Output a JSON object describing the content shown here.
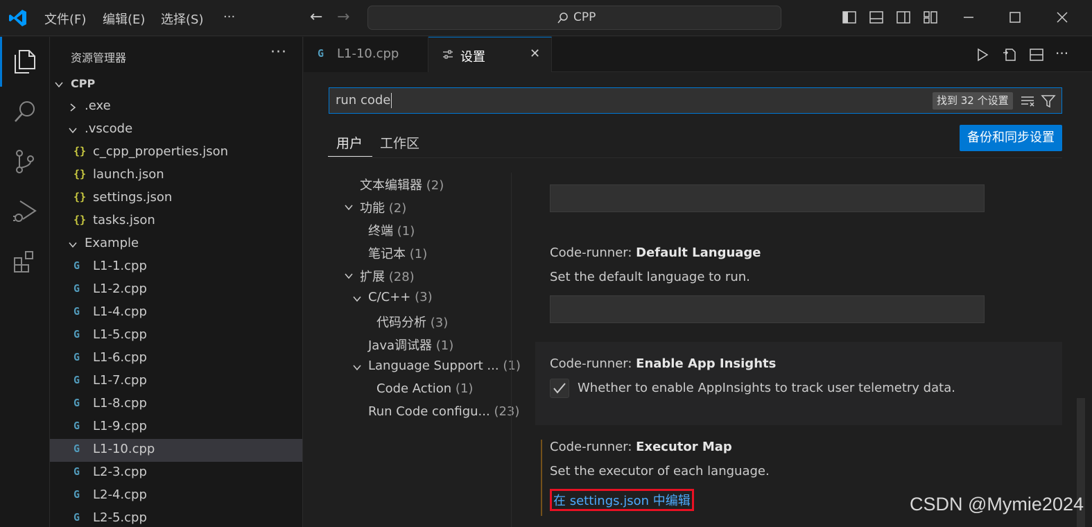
{
  "titlebar": {
    "menu": [
      "文件(F)",
      "编辑(E)",
      "选择(S)",
      "···"
    ],
    "search_text": "CPP"
  },
  "sidebar": {
    "title": "资源管理器",
    "more": "···",
    "tree": [
      {
        "label": "CPP",
        "type": "root"
      },
      {
        "label": ".exe",
        "type": "folder-collapsed"
      },
      {
        "label": ".vscode",
        "type": "folder-open"
      },
      {
        "label": "c_cpp_properties.json",
        "type": "json"
      },
      {
        "label": "launch.json",
        "type": "json"
      },
      {
        "label": "settings.json",
        "type": "json"
      },
      {
        "label": "tasks.json",
        "type": "json"
      },
      {
        "label": "Example",
        "type": "folder-open"
      },
      {
        "label": "L1-1.cpp",
        "type": "cpp"
      },
      {
        "label": "L1-2.cpp",
        "type": "cpp"
      },
      {
        "label": "L1-4.cpp",
        "type": "cpp"
      },
      {
        "label": "L1-5.cpp",
        "type": "cpp"
      },
      {
        "label": "L1-6.cpp",
        "type": "cpp"
      },
      {
        "label": "L1-7.cpp",
        "type": "cpp"
      },
      {
        "label": "L1-8.cpp",
        "type": "cpp"
      },
      {
        "label": "L1-9.cpp",
        "type": "cpp"
      },
      {
        "label": "L1-10.cpp",
        "type": "cpp",
        "selected": true
      },
      {
        "label": "L2-3.cpp",
        "type": "cpp"
      },
      {
        "label": "L2-4.cpp",
        "type": "cpp"
      },
      {
        "label": "L2-5.cpp",
        "type": "cpp"
      }
    ]
  },
  "tabs": [
    {
      "label": "L1-10.cpp",
      "active": false
    },
    {
      "label": "设置",
      "active": true,
      "close": "✕"
    }
  ],
  "settings": {
    "search_value": "run code",
    "found": "找到 32 个设置",
    "scope_tabs": [
      "用户",
      "工作区"
    ],
    "sync_button": "备份和同步设置",
    "toc": [
      {
        "label": "文本编辑器",
        "count": "(2)"
      },
      {
        "label": "功能",
        "count": "(2)"
      },
      {
        "label": "终端",
        "count": "(1)"
      },
      {
        "label": "笔记本",
        "count": "(1)"
      },
      {
        "label": "扩展",
        "count": "(28)"
      },
      {
        "label": "C/C++",
        "count": "(3)"
      },
      {
        "label": "代码分析",
        "count": "(3)"
      },
      {
        "label": "Java调试器",
        "count": "(1)"
      },
      {
        "label": "Language Support ...",
        "count": "(1)"
      },
      {
        "label": "Code Action",
        "count": "(1)"
      },
      {
        "label": "Run Code configu...",
        "count": "(23)"
      }
    ],
    "items": [
      {
        "prefix": "Code-runner: ",
        "name": "Default Language",
        "desc": "Set the default language to run."
      },
      {
        "prefix": "Code-runner: ",
        "name": "Enable App Insights",
        "desc": "Whether to enable AppInsights to track user telemetry data.",
        "checked": true
      },
      {
        "prefix": "Code-runner: ",
        "name": "Executor Map",
        "desc": "Set the executor of each language.",
        "link": "在 settings.json 中编辑"
      }
    ]
  },
  "watermark": "CSDN @Mymie2024",
  "colors": {
    "accent": "#0078d4",
    "link": "#4daafc",
    "highlight_box": "#e81123"
  }
}
